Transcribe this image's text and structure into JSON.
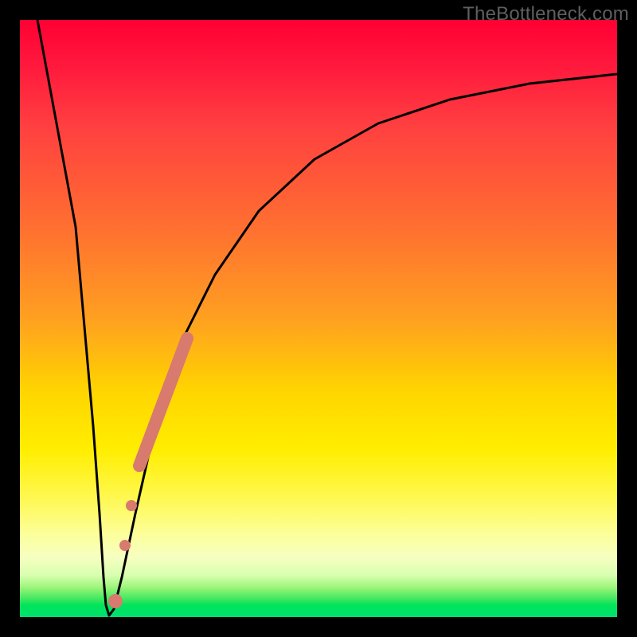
{
  "watermark": "TheBottleneck.com",
  "colors": {
    "frame": "#000000",
    "curve": "#000000",
    "marker": "#d87a6e",
    "gradient_top": "#ff0033",
    "gradient_mid": "#ffd400",
    "gradient_bottom": "#00e070"
  },
  "chart_data": {
    "type": "line",
    "title": "",
    "xlabel": "",
    "ylabel": "",
    "xlim": [
      0,
      100
    ],
    "ylim": [
      0,
      100
    ],
    "grid": false,
    "legend": false,
    "note": "No axis ticks or numeric labels are rendered; values are relative (0–100) estimates read from geometry.",
    "series": [
      {
        "name": "bottleneck-curve",
        "x": [
          3,
          6,
          9,
          11,
          12,
          13,
          14,
          15,
          17,
          20,
          24,
          28,
          33,
          40,
          48,
          58,
          70,
          84,
          100
        ],
        "y": [
          100,
          70,
          35,
          10,
          2,
          0,
          2,
          8,
          20,
          35,
          50,
          60,
          68,
          76,
          82,
          86,
          89,
          91,
          92
        ]
      }
    ],
    "markers": [
      {
        "name": "highlight-segment",
        "shape": "thick-line",
        "color": "#d87a6e",
        "x": [
          18,
          26
        ],
        "y": [
          25,
          55
        ]
      },
      {
        "name": "dot-1",
        "shape": "circle",
        "color": "#d87a6e",
        "x": 16.5,
        "y": 16
      },
      {
        "name": "dot-2",
        "shape": "circle",
        "color": "#d87a6e",
        "x": 15.5,
        "y": 10
      },
      {
        "name": "dot-3",
        "shape": "circle",
        "color": "#d87a6e",
        "x": 14,
        "y": 2
      }
    ]
  }
}
